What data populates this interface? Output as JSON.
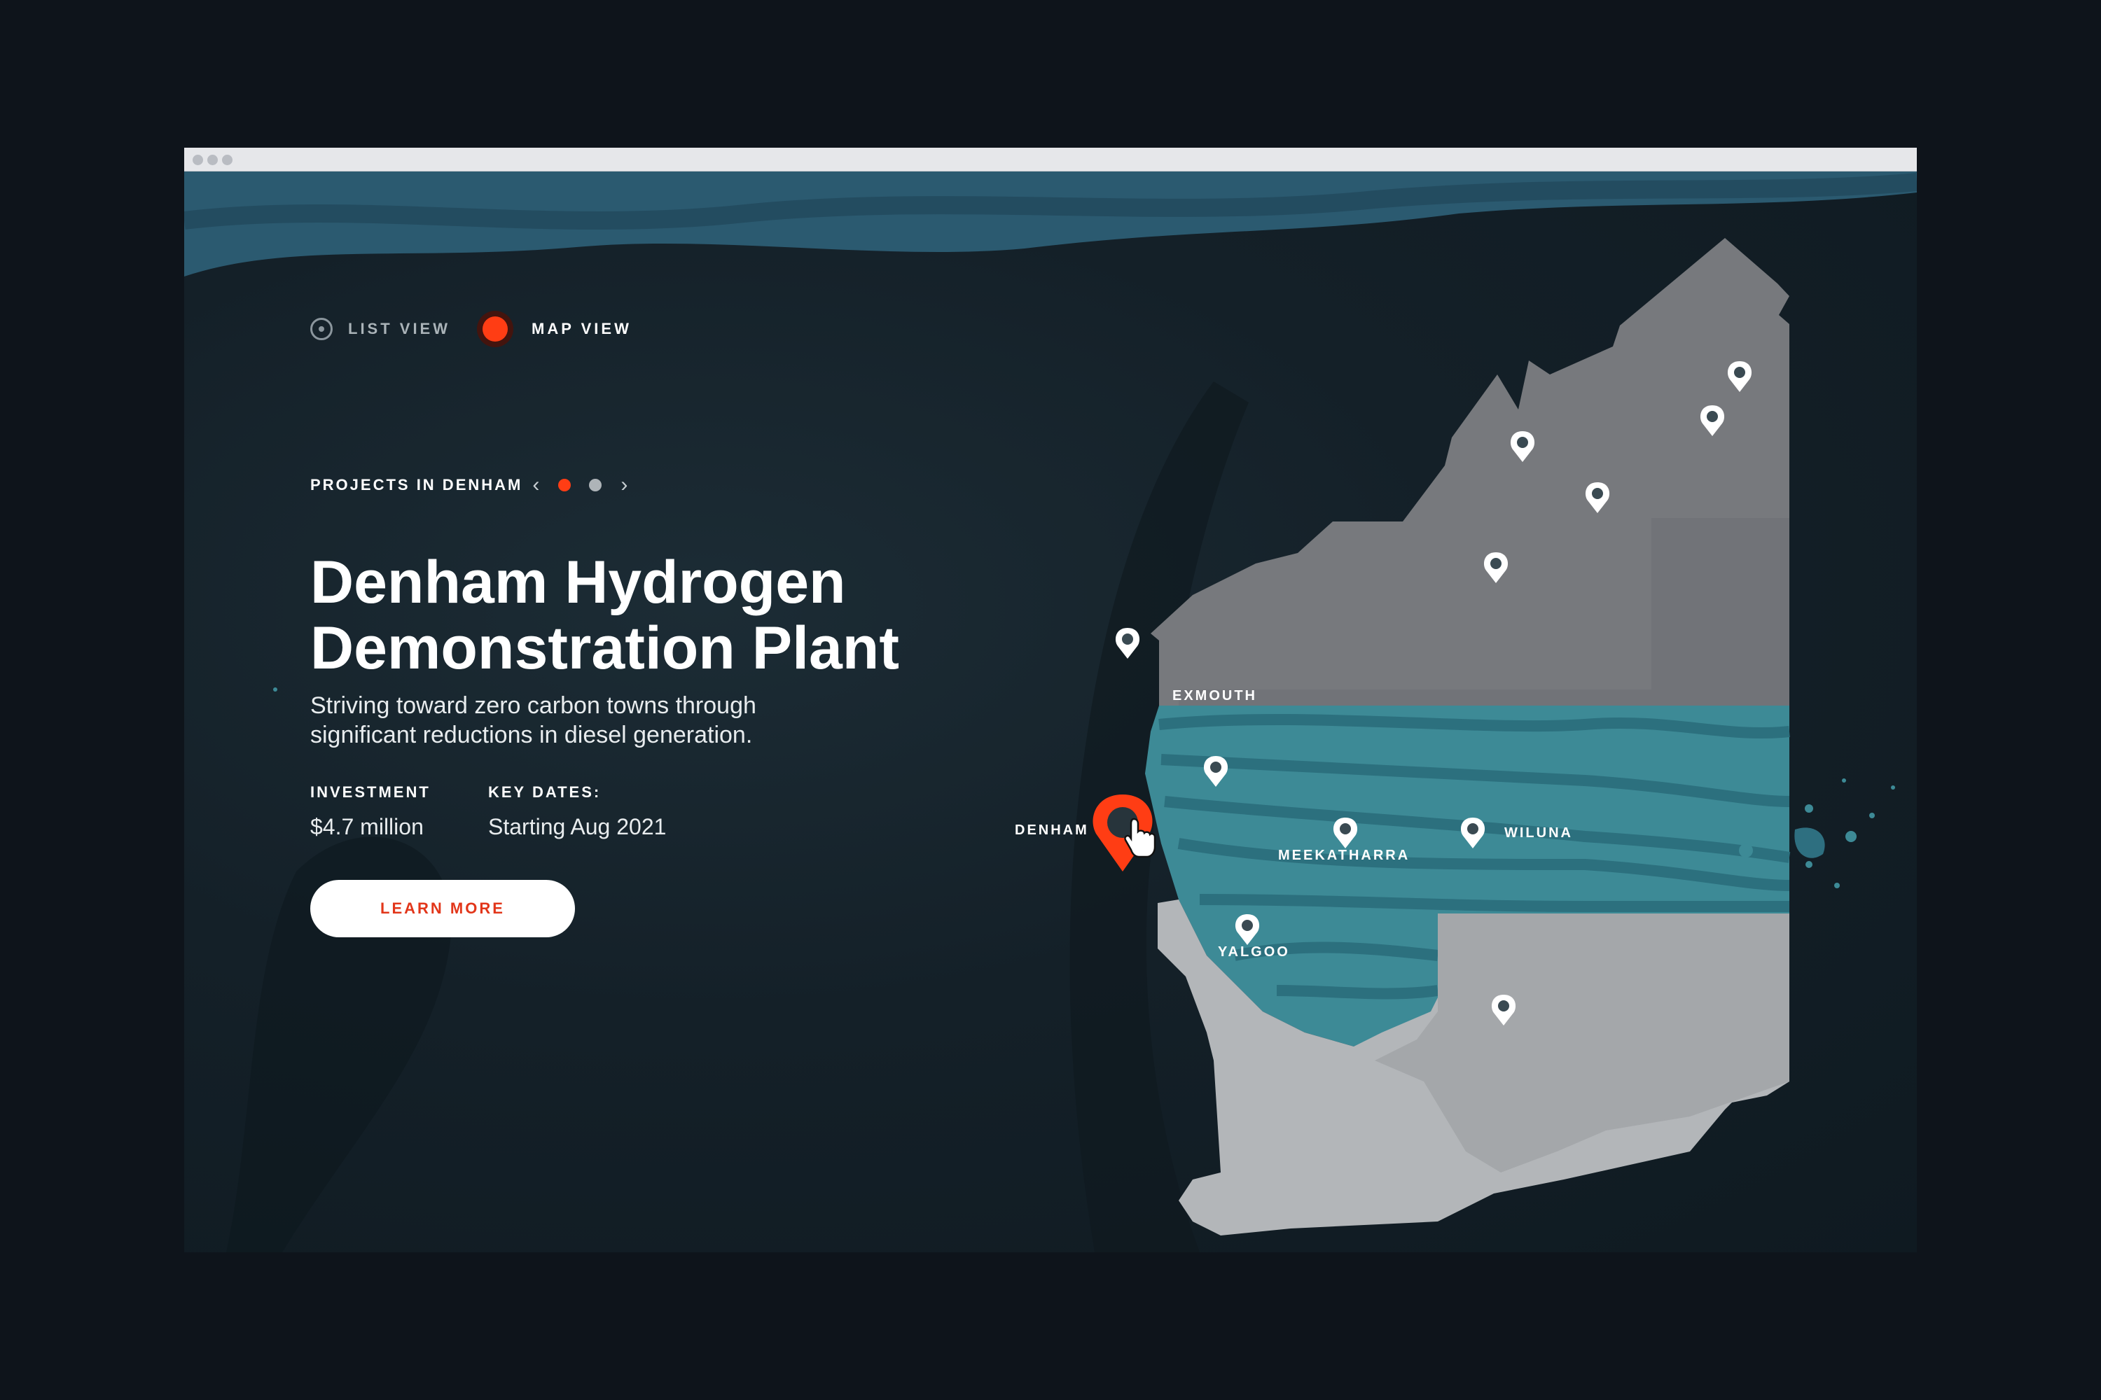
{
  "view_toggle": {
    "list_label": "LIST VIEW",
    "map_label": "MAP VIEW"
  },
  "project_selector": {
    "label": "PROJECTS IN DENHAM",
    "pages": 2,
    "current": 1
  },
  "project": {
    "title_line1": "Denham Hydrogen",
    "title_line2": "Demonstration Plant",
    "description_line1": "Striving toward zero carbon towns through",
    "description_line2": "significant reductions in diesel generation.",
    "investment_label": "INVESTMENT",
    "investment_value": "$4.7 million",
    "dates_label": "KEY DATES:",
    "dates_value": "Starting Aug 2021",
    "cta_label": "LEARN MORE"
  },
  "map": {
    "labels": {
      "exmouth": "EXMOUTH",
      "denham": "DENHAM",
      "meekatharra": "MEEKATHARRA",
      "wiluna": "WILUNA",
      "yalgoo": "YALGOO"
    }
  },
  "colors": {
    "accent": "#ff3d14",
    "background": "#0e141b",
    "region_north": "#77797d",
    "region_mid": "#3d8a96",
    "region_south": "#b3b6b9"
  },
  "icons": {
    "list_radio": "radio-unselected-icon",
    "map_radio": "radio-selected-icon",
    "prev": "chevron-left-icon",
    "next": "chevron-right-icon",
    "pin": "map-pin-icon",
    "cursor": "hand-pointer-icon"
  }
}
